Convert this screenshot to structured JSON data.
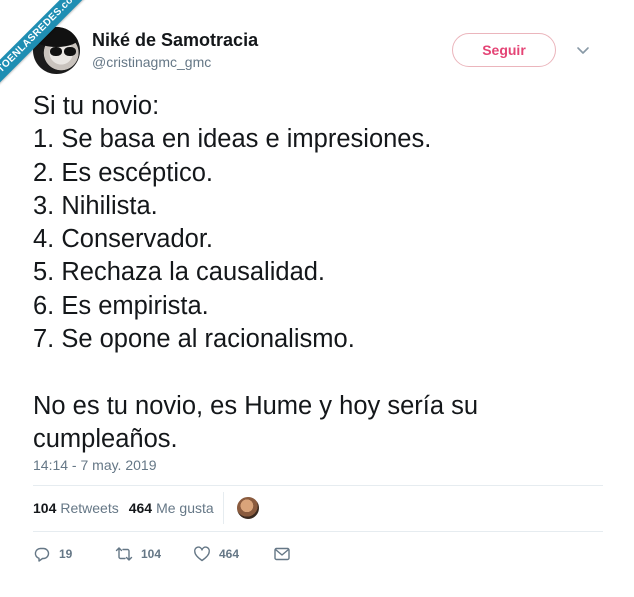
{
  "watermark": {
    "text": "VISTOENLASREDES",
    "suffix": ".com",
    "color": "#1f8eb3"
  },
  "user": {
    "display_name": "Niké de Samotracia",
    "handle": "@cristinagmc_gmc"
  },
  "follow_button": {
    "label": "Seguir",
    "color": "#e0245e"
  },
  "tweet": {
    "lines": [
      "Si tu novio:",
      "1. Se basa en ideas e impresiones.",
      "2. Es escéptico.",
      "3. Nihilista.",
      "4. Conservador.",
      "5. Rechaza la causalidad.",
      "6. Es empirista.",
      "7. Se opone al racionalismo."
    ],
    "closing_lines": [
      "No es tu novio, es Hume y hoy sería su",
      "cumpleaños."
    ],
    "timestamp": "14:14 - 7 may. 2019"
  },
  "stats": {
    "retweets_count": "104",
    "retweets_label": "Retweets",
    "likes_count": "464",
    "likes_label": "Me gusta"
  },
  "actions": {
    "reply_count": "19",
    "retweet_count": "104",
    "like_count": "464",
    "icons": [
      "reply-icon",
      "retweet-icon",
      "heart-icon",
      "message-icon"
    ]
  }
}
